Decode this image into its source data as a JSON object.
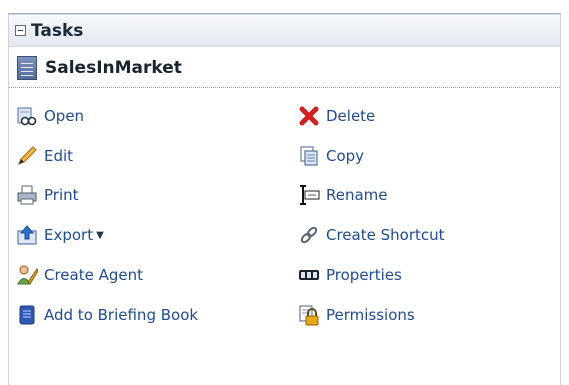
{
  "panel": {
    "title": "Tasks",
    "object_name": "SalesInMarket"
  },
  "tasks": {
    "left": [
      {
        "label": "Open",
        "icon": "open-icon"
      },
      {
        "label": "Edit",
        "icon": "edit-icon"
      },
      {
        "label": "Print",
        "icon": "print-icon"
      },
      {
        "label": "Export",
        "icon": "export-icon",
        "has_dropdown": true
      },
      {
        "label": "Create Agent",
        "icon": "agent-icon"
      },
      {
        "label": "Add to Briefing Book",
        "icon": "briefing-book-icon"
      }
    ],
    "right": [
      {
        "label": "Delete",
        "icon": "delete-icon"
      },
      {
        "label": "Copy",
        "icon": "copy-icon"
      },
      {
        "label": "Rename",
        "icon": "rename-icon"
      },
      {
        "label": "Create Shortcut",
        "icon": "shortcut-icon"
      },
      {
        "label": "Properties",
        "icon": "properties-icon"
      },
      {
        "label": "Permissions",
        "icon": "permissions-icon"
      }
    ]
  },
  "colors": {
    "link": "#1f4a96",
    "header_bg": "#e3e8ef"
  }
}
